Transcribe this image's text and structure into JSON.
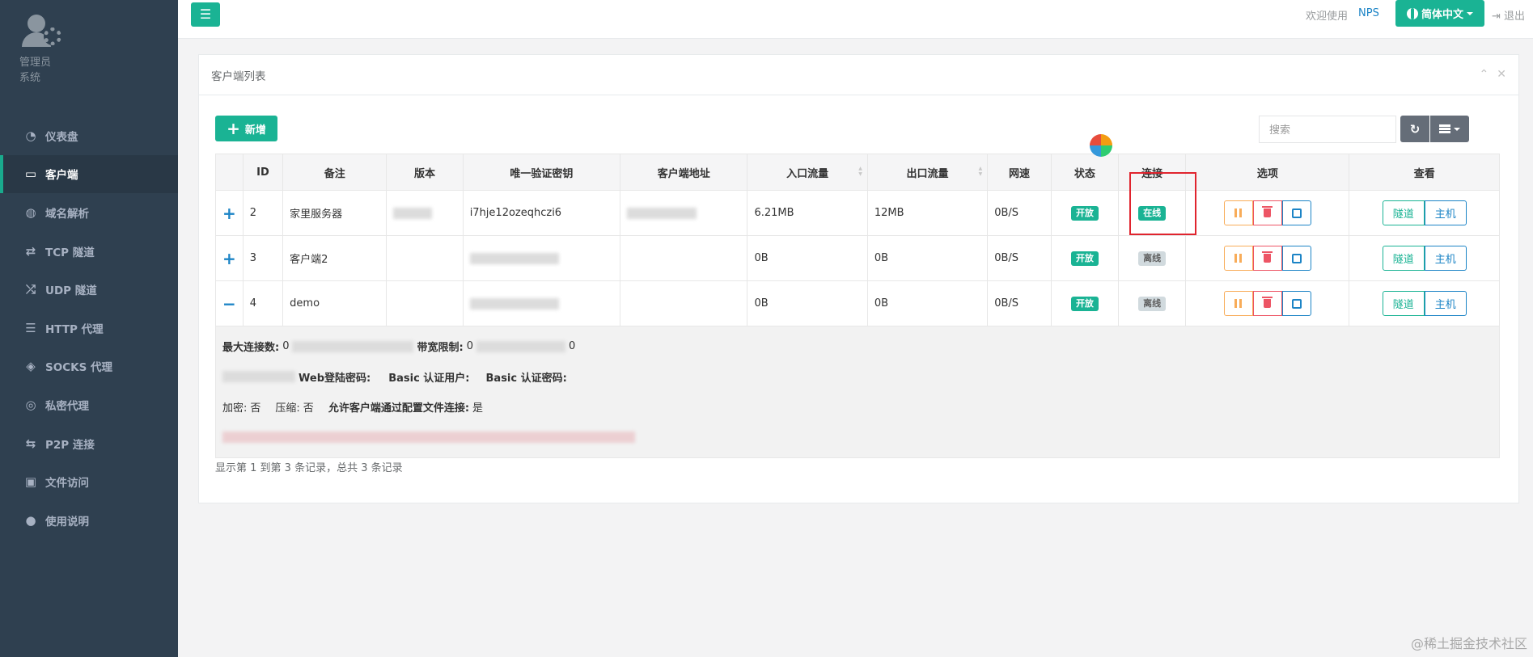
{
  "sidebar": {
    "profile_name": "管理员",
    "profile_role": "系统",
    "items": [
      {
        "label": "仪表盘",
        "icon": "dashboard-icon"
      },
      {
        "label": "客户端",
        "icon": "monitor-icon",
        "active": true
      },
      {
        "label": "域名解析",
        "icon": "globe-icon"
      },
      {
        "label": "TCP 隧道",
        "icon": "retweet-icon"
      },
      {
        "label": "UDP 隧道",
        "icon": "random-icon"
      },
      {
        "label": "HTTP 代理",
        "icon": "server-icon"
      },
      {
        "label": "SOCKS 代理",
        "icon": "layers-icon"
      },
      {
        "label": "私密代理",
        "icon": "eye-slash-icon"
      },
      {
        "label": "P2P 连接",
        "icon": "exchange-icon"
      },
      {
        "label": "文件访问",
        "icon": "briefcase-icon"
      },
      {
        "label": "使用说明",
        "icon": "lightbulb-icon"
      }
    ]
  },
  "topbar": {
    "menu_icon": "☰",
    "welcome": "欢迎使用",
    "app_name": "NPS",
    "language": "简体中文",
    "logout": "退出"
  },
  "panel": {
    "title": "客户端列表",
    "add_label": "新增",
    "search_placeholder": "搜索"
  },
  "table": {
    "headers": [
      "",
      "ID",
      "备注",
      "版本",
      "唯一验证密钥",
      "客户端地址",
      "入口流量",
      "出口流量",
      "网速",
      "状态",
      "连接",
      "选项",
      "查看"
    ],
    "rows": [
      {
        "expand": "+",
        "id": "2",
        "remark": "家里服务器",
        "key": "i7hje12ozeqhczi6",
        "in": "6.21MB",
        "out": "12MB",
        "speed": "0B/S",
        "status": "开放",
        "conn": "在线",
        "conn_state": "online"
      },
      {
        "expand": "+",
        "id": "3",
        "remark": "客户端2",
        "key": "",
        "in": "0B",
        "out": "0B",
        "speed": "0B/S",
        "status": "开放",
        "conn": "离线",
        "conn_state": "offline"
      },
      {
        "expand": "−",
        "id": "4",
        "remark": "demo",
        "key": "",
        "in": "0B",
        "out": "0B",
        "speed": "0B/S",
        "status": "开放",
        "conn": "离线",
        "conn_state": "offline"
      }
    ],
    "view_tunnel": "隧道",
    "view_host": "主机",
    "detail": {
      "max_conn_label": "最大连接数:",
      "max_conn_value": "0",
      "bandwidth_label": "带宽限制:",
      "bandwidth_value": "0",
      "last_value": "0",
      "web_pwd_label": "Web登陆密码:",
      "basic_user_label": "Basic 认证用户:",
      "basic_pwd_label": "Basic 认证密码:",
      "encrypt_label": "加密:",
      "encrypt_value": "否",
      "compress_label": "压缩:",
      "compress_value": "否",
      "config_conn_label": "允许客户端通过配置文件连接:",
      "config_conn_value": "是"
    }
  },
  "footer": "显示第 1 到第 3 条记录，总共 3 条记录",
  "watermark": "@稀土掘金技术社区",
  "colors": {
    "primary": "#1ab394",
    "sidebar": "#2f4050",
    "link": "#1c84c6",
    "danger": "#ed5565",
    "warning": "#f8ac59"
  }
}
